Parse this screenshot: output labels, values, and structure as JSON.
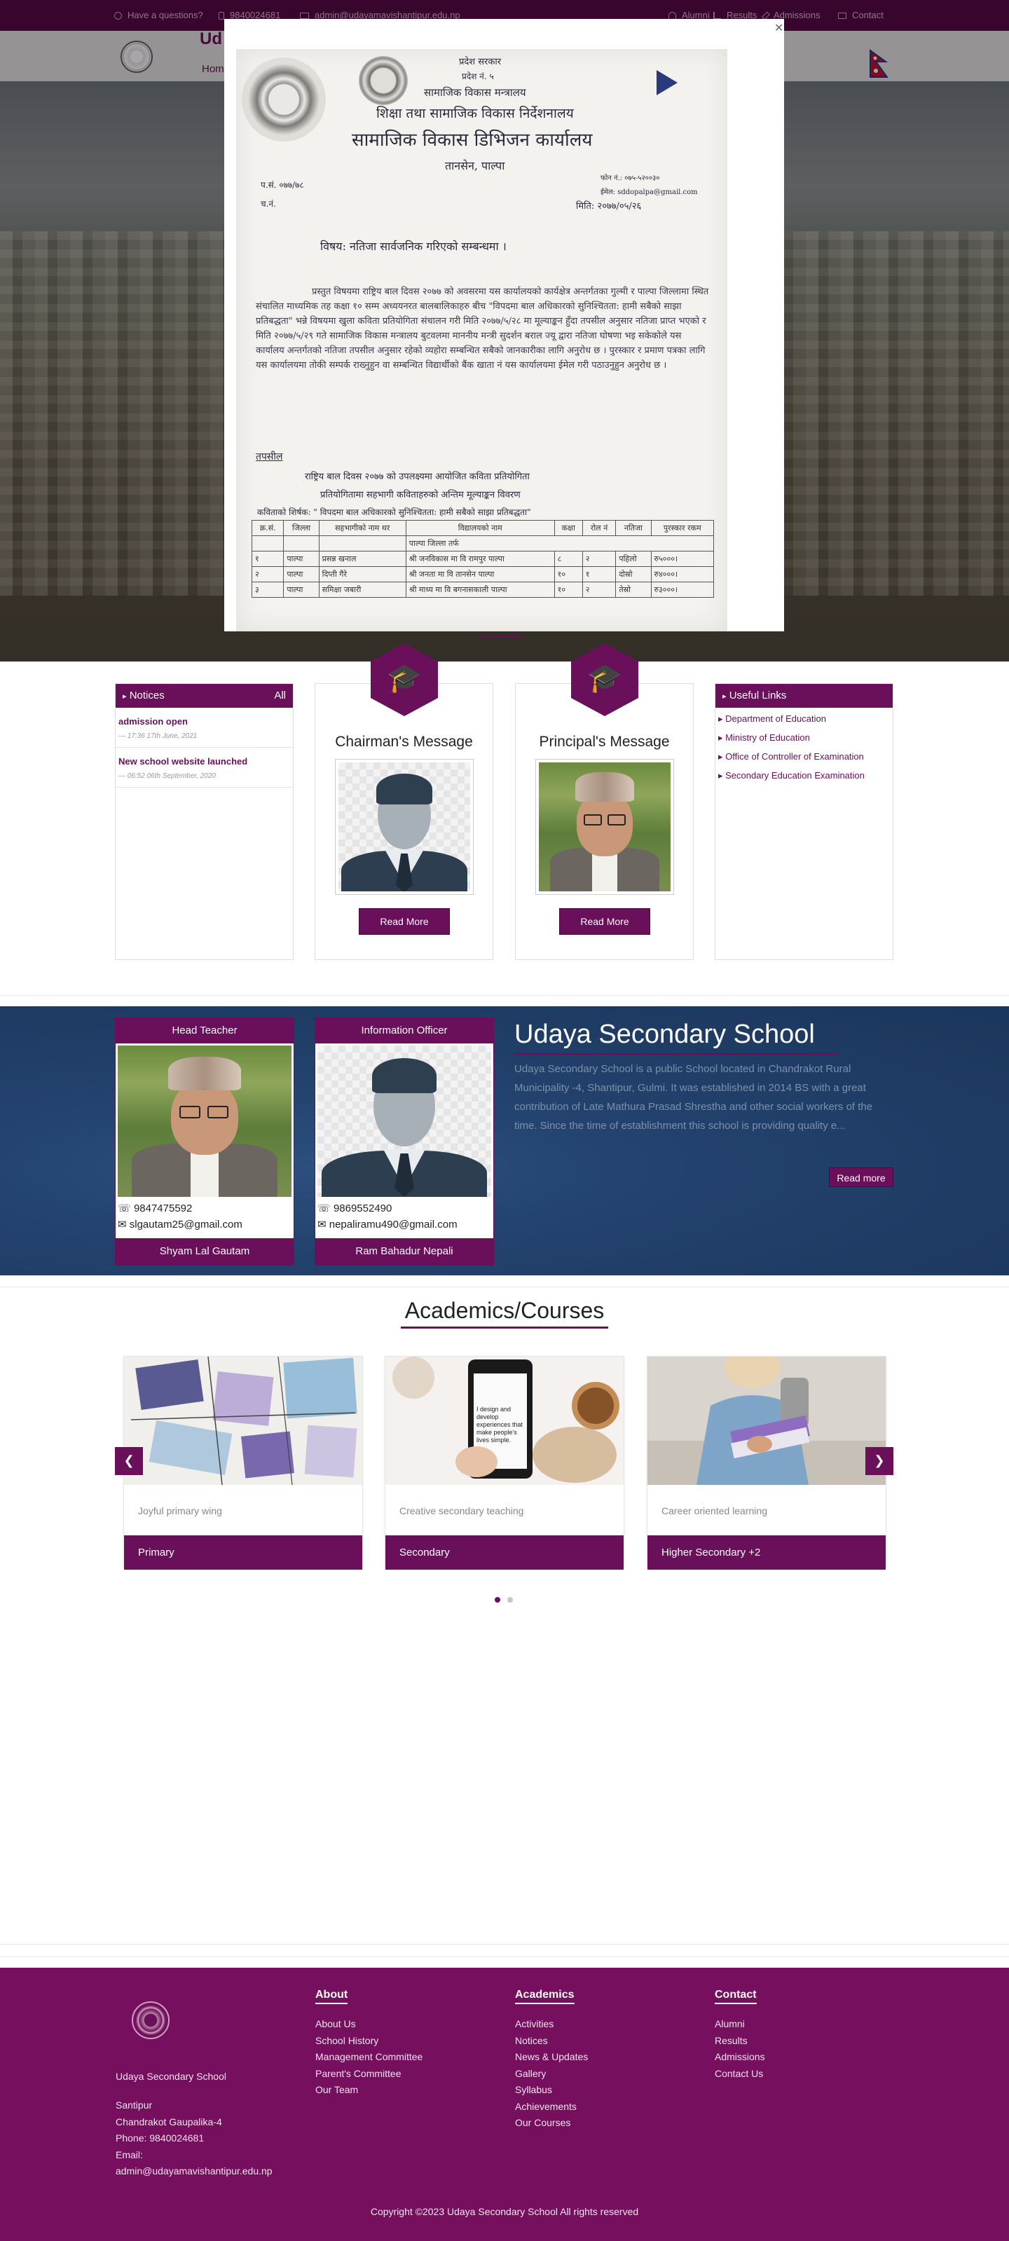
{
  "topbar": {
    "question": "Have a questions?",
    "phone": "9840024681",
    "email": "admin@udayamavishantipur.edu.np",
    "links": [
      "Alumni",
      "Results",
      "Admissions",
      "Contact"
    ]
  },
  "nav": {
    "brand_fragment": "Ud",
    "home_fragment": "Hom"
  },
  "doc": {
    "state": "प्रदेश सरकार",
    "province": "प्रदेश नं. ५",
    "ministry": "सामाजिक विकास मन्त्रालय",
    "directorate": "शिक्षा तथा सामाजिक विकास निर्देशनालय",
    "office": "सामाजिक विकास डिभिजन कार्यालय",
    "place": "तानसेन, पाल्पा",
    "ref_no": "प.सं. ०७७/७८",
    "dispatch": "च.नं.",
    "phone": "फोन नं.: ०७५-५२००३०",
    "email": "ईमेल: sddopalpa@gmail.com",
    "date": "मिति: २०७७/०५/२६",
    "subject": "विषय: नतिजा सार्वजनिक गरिएको सम्बन्धमा ।",
    "body": "प्रस्तुत विषयमा राष्ट्रिय बाल दिवस २०७७ को अवसरमा यस कार्यालयको कार्यक्षेत्र अन्तर्गतका गुल्मी र पाल्पा जिल्लामा स्थित संचालित माध्यमिक तह कक्षा १० सम्म अध्ययनरत बालबालिकाहरु बीच \"विपदमा बाल अधिकारको सुनिश्चितता: हामी सबैको साझा प्रतिबद्धता\" भन्ने विषयमा खुला कविता प्रतियोगिता संचालन गरी मिति २०७७/५/२८ मा मूल्याङ्कन हुँदा तपसील अनुसार नतिजा प्राप्त भएको र मिति २०७७/५/२९ गते सामाजिक विकास मन्त्रालय बुटवलमा माननीय मन्त्री सुदर्शन बराल ज्यू द्वारा नतिजा घोषणा भइ सकेकोले यस कार्यालय अन्तर्गतको नतिजा तपसील अनुसार रहेको व्यहोरा सम्बन्धित सबैको जानकारीका लागि अनुरोध छ । पुरस्कार र प्रमाण पत्रका लागि यस कार्यालयमा तोकी सम्पर्क राख्नुहुन वा सम्बन्धित विद्यार्थीको बैंक खाता नं यस कार्यालयमा ईमेल गरी पठाउनुहुन अनुरोध छ ।",
    "tapasil": "तपसील",
    "sub1": "राष्ट्रिय बाल दिवस २०७७ को उपलक्ष्यमा आयोजित कविता प्रतियोगिता",
    "sub2": "प्रतियोगितामा सहभागी कविताहरुको अन्तिम मूल्याङ्कन विवरण",
    "poem_title": "कविताको शिर्षक: \" विपदमा बाल अधिकारको सुनिश्चितता: हामी सबैको साझा प्रतिबद्धता\"",
    "table_head": [
      "क्र.सं.",
      "जिल्ला",
      "सहभागीको नाम थर",
      "विद्यालयको नाम",
      "कक्षा",
      "रोल नं",
      "नतिजा",
      "पुरस्कार रकम"
    ],
    "table_group": "पाल्पा जिल्ला तर्फ",
    "table_rows": [
      [
        "१",
        "पाल्पा",
        "प्रसन्न खनाल",
        "श्री जनविकास मा वि रामपुर पाल्पा",
        "८",
        "२",
        "पहिलो",
        "रु५०००।"
      ],
      [
        "२",
        "पाल्पा",
        "दिप्ती गैरे",
        "श्री जनता मा वि तानसेन पाल्पा",
        "१०",
        "१",
        "दोस्रो",
        "रु४०००।"
      ],
      [
        "३",
        "पाल्पा",
        "समिक्षा जबारी",
        "श्री माध्य मा वि बगनासकाली पाल्पा",
        "१०",
        "२",
        "तेस्रो",
        "रु३०००।"
      ]
    ]
  },
  "notices": {
    "header": "Notices",
    "all_label": "All",
    "items": [
      {
        "title": "admission open",
        "date": "17:36 17th June, 2021"
      },
      {
        "title": "New school website launched",
        "date": "06:52 06th September, 2020"
      }
    ]
  },
  "chairman": {
    "title": "Chairman's Message",
    "button": "Read More"
  },
  "principal": {
    "title": "Principal's Message",
    "button": "Read More"
  },
  "useful_links": {
    "header": "Useful Links",
    "items": [
      "Department of Education",
      "Ministry of Education",
      "Office of Controller of Examination",
      "Secondary Education Examination"
    ]
  },
  "staff": [
    {
      "role": "Head Teacher",
      "phone": "9847475592",
      "email": "slgautam25@gmail.com",
      "name": "Shyam Lal Gautam"
    },
    {
      "role": "Information Officer",
      "phone": "9869552490",
      "email": "nepaliramu490@gmail.com",
      "name": "Ram Bahadur Nepali"
    }
  ],
  "about": {
    "title": "Udaya Secondary School",
    "description": "Udaya Secondary School is a public School located in Chandrakot Rural Municipality -4, Shantipur, Gulmi. It was established in 2014 BS with a great contribution of Late Mathura Prasad Shrestha and other social workers of the time. Since the time of establishment this school is providing quality e...",
    "button": "Read more"
  },
  "academics": {
    "title": "Academics/Courses",
    "courses": [
      {
        "desc": "Joyful primary wing",
        "name": "Primary"
      },
      {
        "desc": "Creative secondary teaching",
        "name": "Secondary"
      },
      {
        "desc": "Career oriented learning",
        "name": "Higher Secondary +2"
      }
    ],
    "phone_screen_text": "I design and develop experiences that make people's lives simple."
  },
  "footer": {
    "school_name": "Udaya Secondary School",
    "address1": "Santipur",
    "address2": "Chandrakot Gaupalika-4",
    "phone": "Phone: 9840024681",
    "email_label": "Email:",
    "email": "admin@udayamavishantipur.edu.np",
    "about_head": "About",
    "about_links": [
      "About Us",
      "School History",
      "Management Committee",
      "Parent's Committee",
      "Our Team"
    ],
    "academics_head": "Academics",
    "academics_links": [
      "Activities",
      "Notices",
      "News & Updates",
      "Gallery",
      "Syllabus",
      "Achievements",
      "Our Courses"
    ],
    "contact_head": "Contact",
    "contact_links": [
      "Alumni",
      "Results",
      "Admissions",
      "Contact Us"
    ],
    "copyright": "Copyright ©2023 Udaya Secondary School All rights reserved"
  },
  "colors": {
    "brand": "#6a0f5a",
    "topbar": "#560947",
    "footer": "#760f5e",
    "blue_section": "#22416c"
  }
}
